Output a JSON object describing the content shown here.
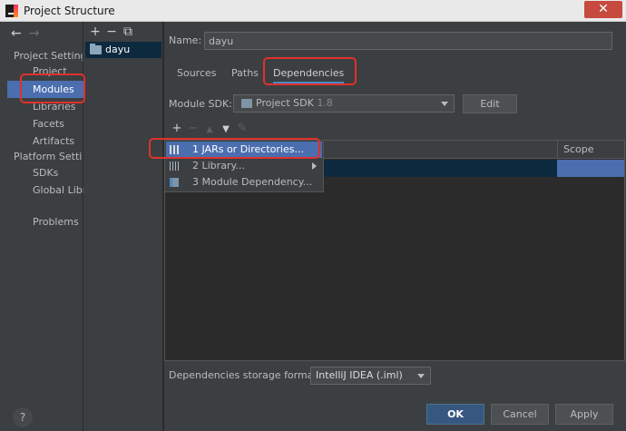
{
  "window": {
    "title": "Project Structure",
    "close_glyph": "✕"
  },
  "navigation": {
    "back_glyph": "←",
    "forward_glyph": "→"
  },
  "sidebar": {
    "project_settings_label": "Project Settings",
    "project_items": [
      "Project",
      "Modules",
      "Libraries",
      "Facets",
      "Artifacts"
    ],
    "platform_settings_label": "Platform Settings",
    "platform_items": [
      "SDKs",
      "Global Libraries"
    ],
    "problems_label": "Problems",
    "selected": "Modules"
  },
  "modules_panel": {
    "toolbar": {
      "add_glyph": "+",
      "remove_glyph": "−",
      "copy_glyph": "⧉"
    },
    "items": [
      "dayu"
    ]
  },
  "main": {
    "name_label": "Name:",
    "name_value": "dayu",
    "tabs": [
      "Sources",
      "Paths",
      "Dependencies"
    ],
    "active_tab": "Dependencies",
    "module_sdk_label": "Module SDK:",
    "module_sdk_value": "Project SDK",
    "module_sdk_version": "1.8",
    "edit_label": "Edit",
    "dep_toolbar": {
      "add_glyph": "+",
      "remove_glyph": "−",
      "up_glyph": "▲",
      "down_glyph": "▼",
      "edit_glyph": "✎"
    },
    "table": {
      "scope_header": "Scope"
    },
    "add_menu": [
      {
        "number": "1",
        "label": "JARs or Directories..."
      },
      {
        "number": "2",
        "label": "Library..."
      },
      {
        "number": "3",
        "label": "Module Dependency..."
      }
    ],
    "storage_label": "Dependencies storage format:",
    "storage_value": "IntelliJ IDEA (.iml)"
  },
  "footer": {
    "help_glyph": "?",
    "ok_label": "OK",
    "cancel_label": "Cancel",
    "apply_label": "Apply"
  },
  "colors": {
    "selection": "#4b6eaf",
    "background": "#3c3f41",
    "annotation": "#e0312c"
  }
}
